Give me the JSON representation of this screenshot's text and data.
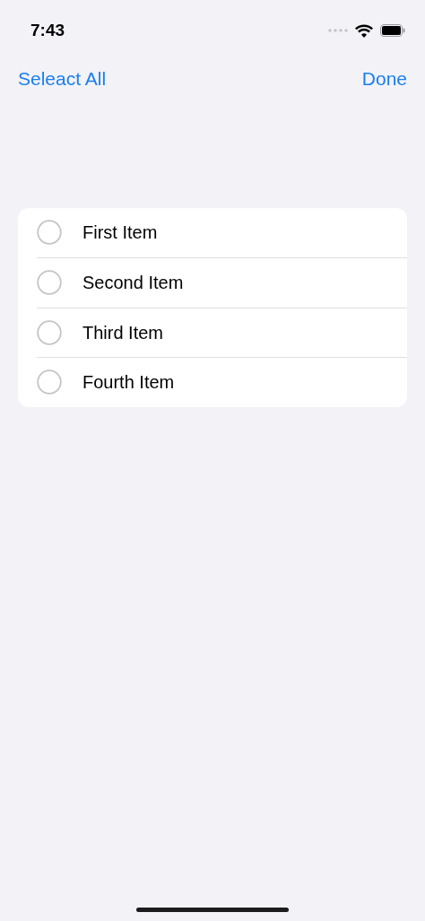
{
  "status_bar": {
    "time": "7:43"
  },
  "nav": {
    "left_button": "Seleact All",
    "right_button": "Done"
  },
  "items": [
    {
      "label": "First Item",
      "selected": false
    },
    {
      "label": "Second Item",
      "selected": false
    },
    {
      "label": "Third Item",
      "selected": false
    },
    {
      "label": "Fourth Item",
      "selected": false
    }
  ]
}
